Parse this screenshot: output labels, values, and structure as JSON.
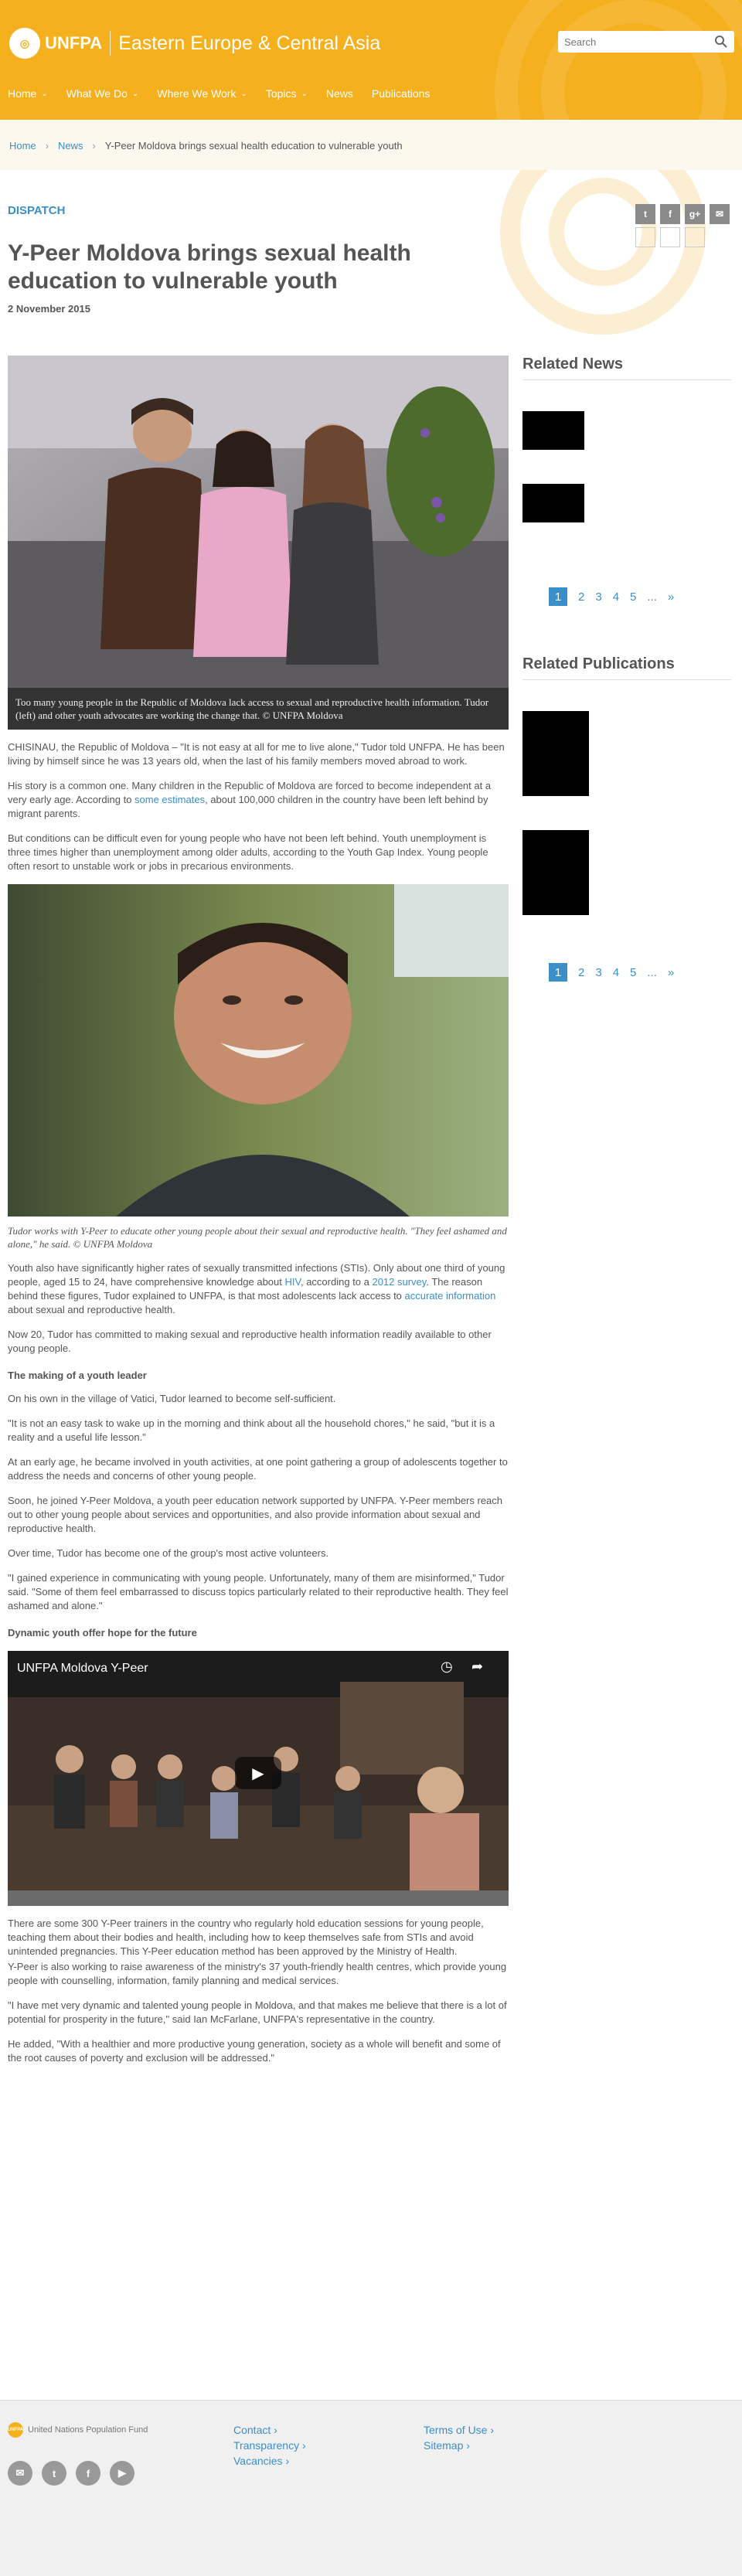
{
  "header": {
    "logo_text": "UNFPA",
    "region": "Eastern Europe & Central Asia",
    "search_placeholder": "Search"
  },
  "nav": [
    {
      "label": "Home",
      "has_dropdown": true
    },
    {
      "label": "What We Do",
      "has_dropdown": true
    },
    {
      "label": "Where We Work",
      "has_dropdown": true
    },
    {
      "label": "Topics",
      "has_dropdown": true
    },
    {
      "label": "News",
      "has_dropdown": false
    },
    {
      "label": "Publications",
      "has_dropdown": false
    }
  ],
  "breadcrumb": {
    "home": "Home",
    "news": "News",
    "current": "Y-Peer Moldova brings sexual health education to vulnerable youth"
  },
  "article": {
    "category": "DISPATCH",
    "title": "Y-Peer Moldova brings sexual health education to vulnerable youth",
    "date": "2 November 2015",
    "photo1_caption": "Too many young people in the Republic of Moldova lack access to sexual and reproductive health information. Tudor (left) and other youth advocates are working the change that. © UNFPA Moldova",
    "p1": "CHISINAU, the Republic of Moldova – \"It is not easy at all for me to live alone,\" Tudor told UNFPA. He has been living by himself since he was 13 years old, when the last of his family members moved abroad to work.",
    "p2_a": "His story is a common one. Many children in the Republic of Moldova are forced to become independent at a very early age. According to ",
    "p2_link": "some estimates",
    "p2_b": ", about 100,000 children in the country have been left behind by migrant parents.",
    "p3": "But conditions can be difficult even for young people who have not been left behind. Youth unemployment is three times higher than unemployment among older adults, according to the Youth Gap Index. Young people often resort to unstable work or jobs in precarious environments.",
    "photo2_caption": "Tudor works with Y-Peer to educate other young people about their sexual and reproductive health. \"They feel ashamed and alone,\" he said. © UNFPA Moldova",
    "p4_a": "Youth also have significantly higher rates of sexually transmitted infections (STIs). Only about one third of young people, aged 15 to 24, have comprehensive knowledge about ",
    "p4_link1": "HIV",
    "p4_b": ", according to a ",
    "p4_link2": "2012 survey",
    "p4_c": ". The reason behind these figures, Tudor explained to UNFPA, is that most adolescents lack access to ",
    "p4_link3": "accurate information",
    "p4_d": " about sexual and reproductive health.",
    "p5": "Now 20, Tudor has committed to making sexual and reproductive health information readily available to other young people.",
    "subhead1": "The making of a youth leader",
    "p6": "On his own in the village of Vatici, Tudor learned to become self-sufficient.",
    "p7": "\"It is not an easy task to wake up in the morning and think about all the household chores,\" he said, \"but it is a reality and a useful life lesson.\"",
    "p8": "At an early age, he became involved in youth activities, at one point gathering a group of adolescents together to address the needs and concerns of other young people.",
    "p9": "Soon, he joined Y-Peer Moldova, a youth peer education network supported by UNFPA. Y-Peer members reach out to other young people about services and opportunities, and also provide information about sexual and reproductive health.",
    "p10": "Over time, Tudor has become one of the group's most active volunteers.",
    "p11": "\"I gained experience in communicating with young people. Unfortunately, many of them are misinformed,\" Tudor said. \"Some of them feel embarrassed to discuss topics particularly related to their reproductive health. They feel ashamed and alone.\"",
    "subhead2": "Dynamic youth offer hope for the future",
    "video_title": "UNFPA Moldova Y-Peer",
    "p12": "There are some 300 Y-Peer trainers in the country who regularly hold education sessions for young people, teaching them about their bodies and health, including how to keep themselves safe from STIs and avoid unintended pregnancies. This Y-Peer education method has been approved by the Ministry of Health.",
    "p13": "Y-Peer is also working to raise awareness of the ministry's 37 youth-friendly health centres, which provide young people with counselling, information, family planning and medical services.",
    "p14": "\"I have met very dynamic and talented young people in Moldova, and that makes me believe that there is a lot of potential for prosperity in the future,\" said Ian McFarlane, UNFPA's representative in the country.",
    "p15": "He added, \"With a healthier and more productive young generation, society as a whole will benefit and some of the root causes of poverty and exclusion will be addressed.\""
  },
  "sidebar": {
    "related_news_title": "Related News",
    "related_publications_title": "Related Publications",
    "pager": [
      "1",
      "2",
      "3",
      "4",
      "5",
      "...",
      "»"
    ]
  },
  "footer": {
    "org": "United Nations Population Fund",
    "links_col1": [
      "Contact ›",
      "Transparency ›",
      "Vacancies ›"
    ],
    "links_col2": [
      "Terms of Use ›",
      "Sitemap ›"
    ],
    "social": [
      "✉",
      "t",
      "f",
      "▶"
    ]
  },
  "colors": {
    "brand": "#f5b01e",
    "link": "#3a8fc8"
  }
}
